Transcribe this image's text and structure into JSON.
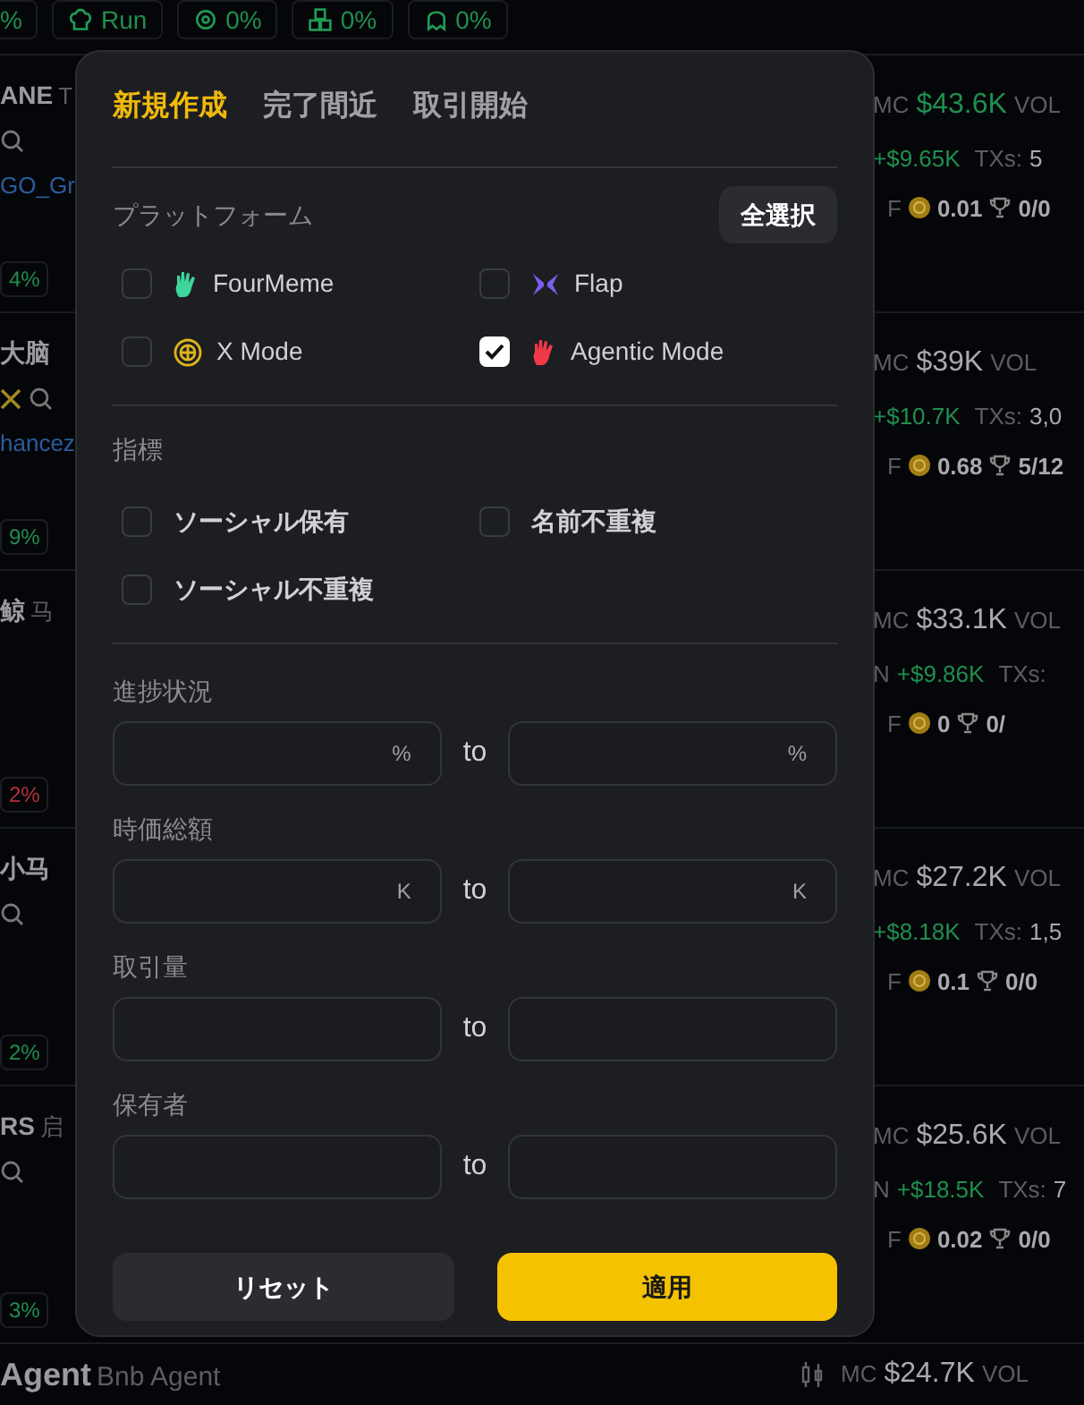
{
  "top_chips": [
    {
      "text": "%"
    },
    {
      "text": "Run"
    },
    {
      "text": "0%"
    },
    {
      "text": "0%"
    },
    {
      "text": "0%"
    }
  ],
  "tokens": [
    {
      "name": "ANE",
      "subtitle": "T",
      "link": "GO_Gr",
      "chip": {
        "text": "4%",
        "color": "#1f8f4e"
      },
      "mc_label": "MC",
      "mc": "$43.6K",
      "vol_label": "VOL",
      "change": "+$9.65K",
      "txs_label": "TXs:",
      "txs": "5",
      "f_label": "F",
      "f_value": "0.01",
      "trophy": "0/0"
    },
    {
      "name": "大脑",
      "link": "hancez",
      "chip": {
        "text": "9%",
        "color": "#1f8f4e"
      },
      "mc_label": "MC",
      "mc": "$39K",
      "vol_label": "VOL",
      "change": "+$10.7K",
      "txs_label": "TXs:",
      "txs": "3,0",
      "f_label": "F",
      "f_value": "0.68",
      "trophy": "5/12"
    },
    {
      "name": "鲸",
      "subtitle": "马",
      "chip": {
        "text": "2%",
        "color": "#b3303a"
      },
      "mc_label": "MC",
      "mc": "$33.1K",
      "vol_label": "VOL",
      "change_prefix": "N",
      "change": "+$9.86K",
      "txs_label": "TXs:",
      "f_label": "F",
      "f_value": "0",
      "trophy": "0/"
    },
    {
      "name": "小马",
      "chip": {
        "text": "2%",
        "color": "#1f8f4e"
      },
      "mc_label": "MC",
      "mc": "$27.2K",
      "vol_label": "VOL",
      "change": "+$8.18K",
      "txs_label": "TXs:",
      "txs": "1,5",
      "f_label": "F",
      "f_value": "0.1",
      "trophy": "0/0"
    },
    {
      "name": "RS",
      "subtitle": "启",
      "chip": {
        "text": "3%",
        "color": "#1f8f4e"
      },
      "mc_label": "MC",
      "mc": "$25.6K",
      "vol_label": "VOL",
      "change_prefix": "N",
      "change": "+$18.5K",
      "txs_label": "TXs:",
      "txs": "7",
      "f_label": "F",
      "f_value": "0.02",
      "trophy": "0/0"
    },
    {
      "name": "Agent",
      "subtitle": "Bnb Agent",
      "mc_label": "MC",
      "mc": "$24.7K",
      "vol_label": "VOL"
    }
  ],
  "filter": {
    "tabs": [
      {
        "label": "新規作成",
        "selected": true
      },
      {
        "label": "完了間近",
        "selected": false
      },
      {
        "label": "取引開始",
        "selected": false
      }
    ],
    "platform": {
      "title": "プラットフォーム",
      "select_all": "全選択",
      "options": [
        {
          "label": "FourMeme",
          "checked": false
        },
        {
          "label": "Flap",
          "checked": false
        },
        {
          "label": "X Mode",
          "checked": false
        },
        {
          "label": "Agentic Mode",
          "checked": true
        }
      ]
    },
    "metrics": {
      "title": "指標",
      "options": [
        {
          "label": "ソーシャル保有",
          "checked": false
        },
        {
          "label": "名前不重複",
          "checked": false
        },
        {
          "label": "ソーシャル不重複",
          "checked": false
        }
      ]
    },
    "ranges": [
      {
        "label": "進捗状況",
        "unit_from": "%",
        "unit_to": "%",
        "separator": "to"
      },
      {
        "label": "時価総額",
        "unit_from": "K",
        "unit_to": "K",
        "separator": "to"
      },
      {
        "label": "取引量",
        "separator": "to"
      },
      {
        "label": "保有者",
        "separator": "to"
      }
    ],
    "reset": "リセット",
    "apply": "適用"
  }
}
